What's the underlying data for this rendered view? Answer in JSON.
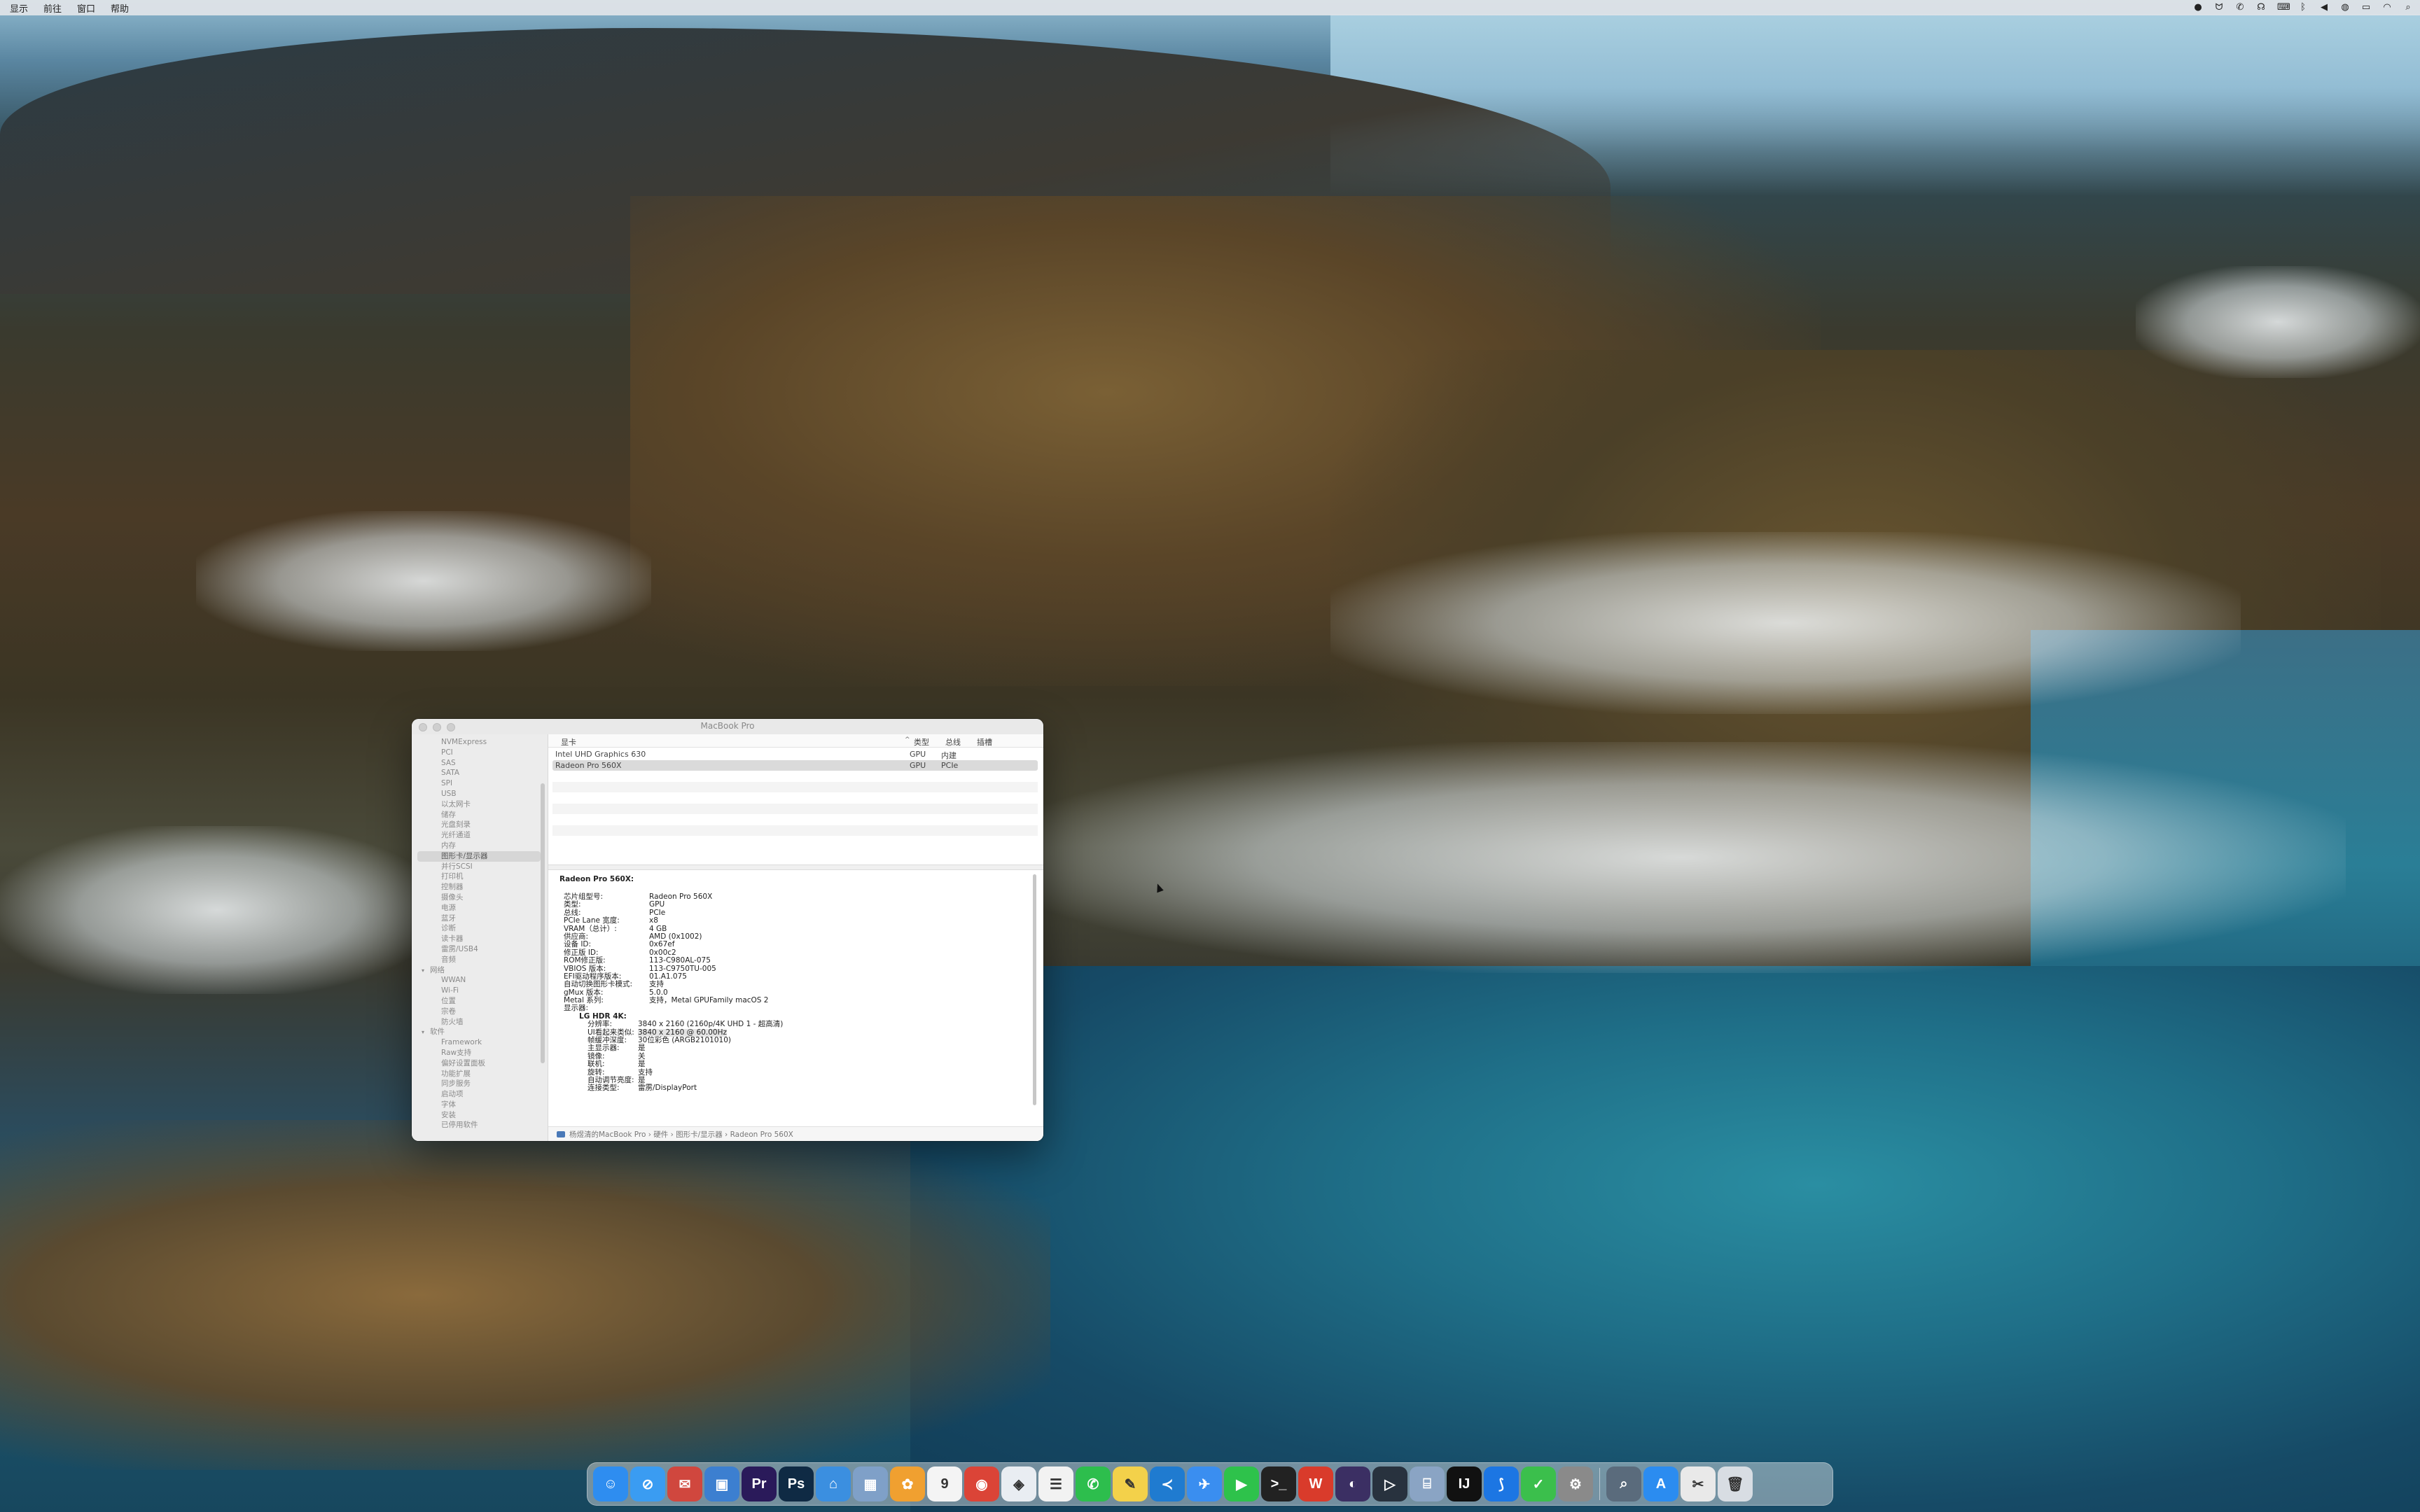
{
  "menubar": {
    "items": [
      "显示",
      "前往",
      "窗口",
      "帮助"
    ],
    "status_icons": [
      "record-icon",
      "butterfly-icon",
      "wechat-icon",
      "headphones-icon",
      "keyboard-icon",
      "bluetooth-icon",
      "volume-icon",
      "siri-icon",
      "battery-icon",
      "wifi-icon",
      "search-icon"
    ]
  },
  "window": {
    "title": "MacBook Pro",
    "sidebar": {
      "items": [
        {
          "label": "NVMExpress",
          "type": "item"
        },
        {
          "label": "PCI",
          "type": "item"
        },
        {
          "label": "SAS",
          "type": "item"
        },
        {
          "label": "SATA",
          "type": "item"
        },
        {
          "label": "SPI",
          "type": "item"
        },
        {
          "label": "USB",
          "type": "item"
        },
        {
          "label": "以太网卡",
          "type": "item"
        },
        {
          "label": "储存",
          "type": "item"
        },
        {
          "label": "光盘刻录",
          "type": "item"
        },
        {
          "label": "光纤通道",
          "type": "item"
        },
        {
          "label": "内存",
          "type": "item"
        },
        {
          "label": "图形卡/显示器",
          "type": "selected"
        },
        {
          "label": "并行SCSI",
          "type": "item"
        },
        {
          "label": "打印机",
          "type": "item"
        },
        {
          "label": "控制器",
          "type": "item"
        },
        {
          "label": "摄像头",
          "type": "item"
        },
        {
          "label": "电源",
          "type": "item"
        },
        {
          "label": "蓝牙",
          "type": "item"
        },
        {
          "label": "诊断",
          "type": "item"
        },
        {
          "label": "读卡器",
          "type": "item"
        },
        {
          "label": "雷雳/USB4",
          "type": "item"
        },
        {
          "label": "音频",
          "type": "item"
        },
        {
          "label": "网络",
          "type": "section"
        },
        {
          "label": "WWAN",
          "type": "item"
        },
        {
          "label": "Wi-Fi",
          "type": "item"
        },
        {
          "label": "位置",
          "type": "item"
        },
        {
          "label": "宗卷",
          "type": "item"
        },
        {
          "label": "防火墙",
          "type": "item"
        },
        {
          "label": "软件",
          "type": "section"
        },
        {
          "label": "Framework",
          "type": "item"
        },
        {
          "label": "Raw支持",
          "type": "item"
        },
        {
          "label": "偏好设置面板",
          "type": "item"
        },
        {
          "label": "功能扩展",
          "type": "item"
        },
        {
          "label": "同步服务",
          "type": "item"
        },
        {
          "label": "启动项",
          "type": "item"
        },
        {
          "label": "字体",
          "type": "item"
        },
        {
          "label": "安装",
          "type": "item"
        },
        {
          "label": "已停用软件",
          "type": "item"
        }
      ]
    },
    "table": {
      "headers": [
        "显卡",
        "类型",
        "总线",
        "插槽"
      ],
      "sort_indicator": "^",
      "rows": [
        {
          "name": "Intel UHD Graphics 630",
          "type": "GPU",
          "bus": "内建",
          "slot": ""
        },
        {
          "name": "Radeon Pro 560X",
          "type": "GPU",
          "bus": "PCIe",
          "slot": ""
        }
      ]
    },
    "detail": {
      "heading": "Radeon Pro 560X:",
      "fields": [
        {
          "k": "芯片组型号:",
          "v": "Radeon Pro 560X"
        },
        {
          "k": "类型:",
          "v": "GPU"
        },
        {
          "k": "总线:",
          "v": "PCIe"
        },
        {
          "k": "PCIe Lane 宽度:",
          "v": "x8"
        },
        {
          "k": "VRAM（总计）:",
          "v": "4 GB"
        },
        {
          "k": "供应商:",
          "v": "AMD (0x1002)"
        },
        {
          "k": "设备 ID:",
          "v": "0x67ef"
        },
        {
          "k": "修正版 ID:",
          "v": "0x00c2"
        },
        {
          "k": "ROM修正版:",
          "v": "113-C980AL-075"
        },
        {
          "k": "VBIOS 版本:",
          "v": "113-C9750TU-005"
        },
        {
          "k": "EFI驱动程序版本:",
          "v": "01.A1.075"
        },
        {
          "k": "自动切换图形卡模式:",
          "v": "支持"
        },
        {
          "k": "gMux 版本:",
          "v": "5.0.0"
        },
        {
          "k": "Metal 系列:",
          "v": "支持，Metal GPUFamily macOS 2"
        },
        {
          "k": "显示器:",
          "v": ""
        }
      ],
      "display_name": "LG HDR 4K:",
      "display_fields": [
        {
          "k": "分辨率:",
          "v": "3840 x 2160 (2160p/4K UHD 1 - 超高清)",
          "hl": false
        },
        {
          "k": "UI看起来类似:",
          "v": "3840 x 2160 @ 60.00Hz",
          "hl": true
        },
        {
          "k": "帧缓冲深度:",
          "v": "30位彩色 (ARGB2101010)",
          "hl": false
        },
        {
          "k": "主显示器:",
          "v": "是",
          "hl": false
        },
        {
          "k": "镜像:",
          "v": "关",
          "hl": false
        },
        {
          "k": "联机:",
          "v": "是",
          "hl": false
        },
        {
          "k": "旋转:",
          "v": "支持",
          "hl": false
        },
        {
          "k": "自动调节亮度:",
          "v": "是",
          "hl": false
        },
        {
          "k": "连接类型:",
          "v": "雷雳/DisplayPort",
          "hl": false
        }
      ]
    },
    "pathbar": [
      "杨煜清的MacBook Pro",
      "硬件",
      "图形卡/显示器",
      "Radeon Pro 560X"
    ]
  },
  "dock": {
    "apps": [
      {
        "name": "finder",
        "glyph": "☺",
        "color": "#2e8df0"
      },
      {
        "name": "safari",
        "glyph": "⊘",
        "color": "#3a9cf2"
      },
      {
        "name": "thunderbird",
        "glyph": "✉",
        "color": "#d0473e"
      },
      {
        "name": "preview",
        "glyph": "▣",
        "color": "#3c7fd0"
      },
      {
        "name": "premiere",
        "glyph": "Pr",
        "color": "#2a1a5a"
      },
      {
        "name": "photoshop",
        "glyph": "Ps",
        "color": "#0f2a44"
      },
      {
        "name": "keynote",
        "glyph": "⌂",
        "color": "#3b8fe0"
      },
      {
        "name": "screenshots",
        "glyph": "▦",
        "color": "#7fa0c8"
      },
      {
        "name": "photos",
        "glyph": "✿",
        "color": "#f0a030"
      },
      {
        "name": "calendar",
        "glyph": "9",
        "color": "#f4f4f4"
      },
      {
        "name": "chrome",
        "glyph": "◉",
        "color": "#db4437"
      },
      {
        "name": "figma",
        "glyph": "◈",
        "color": "#e9edf2"
      },
      {
        "name": "reminders",
        "glyph": "☰",
        "color": "#f2f2f2"
      },
      {
        "name": "wechat",
        "glyph": "✆",
        "color": "#2dbe4d"
      },
      {
        "name": "notes",
        "glyph": "✎",
        "color": "#f3d14a"
      },
      {
        "name": "vscode",
        "glyph": "≺",
        "color": "#1f7bd0"
      },
      {
        "name": "feishu",
        "glyph": "✈",
        "color": "#3a8ef0"
      },
      {
        "name": "facetime",
        "glyph": "▶",
        "color": "#2ec24b"
      },
      {
        "name": "terminal",
        "glyph": ">_",
        "color": "#222"
      },
      {
        "name": "wps",
        "glyph": "W",
        "color": "#d93b2b"
      },
      {
        "name": "eclipse",
        "glyph": "◐",
        "color": "#3b2f63"
      },
      {
        "name": "quicktime",
        "glyph": "▷",
        "color": "#28323e"
      },
      {
        "name": "android-file-transfer",
        "glyph": "⌸",
        "color": "#8aa4c4"
      },
      {
        "name": "intellij",
        "glyph": "IJ",
        "color": "#111"
      },
      {
        "name": "lark",
        "glyph": "⟆",
        "color": "#1c76e3"
      },
      {
        "name": "tick",
        "glyph": "✓",
        "color": "#3bbf4c"
      },
      {
        "name": "system-preferences",
        "glyph": "⚙",
        "color": "#8a8a8a"
      }
    ],
    "after_sep": [
      {
        "name": "spotlight-folder",
        "glyph": "⌕",
        "color": "#5a6b7c"
      },
      {
        "name": "app-store",
        "glyph": "A",
        "color": "#2b8cf0"
      },
      {
        "name": "screenshot-utility",
        "glyph": "✂",
        "color": "#e9e9e9"
      },
      {
        "name": "trash",
        "glyph": "🗑",
        "color": "#d8dde3"
      }
    ]
  }
}
